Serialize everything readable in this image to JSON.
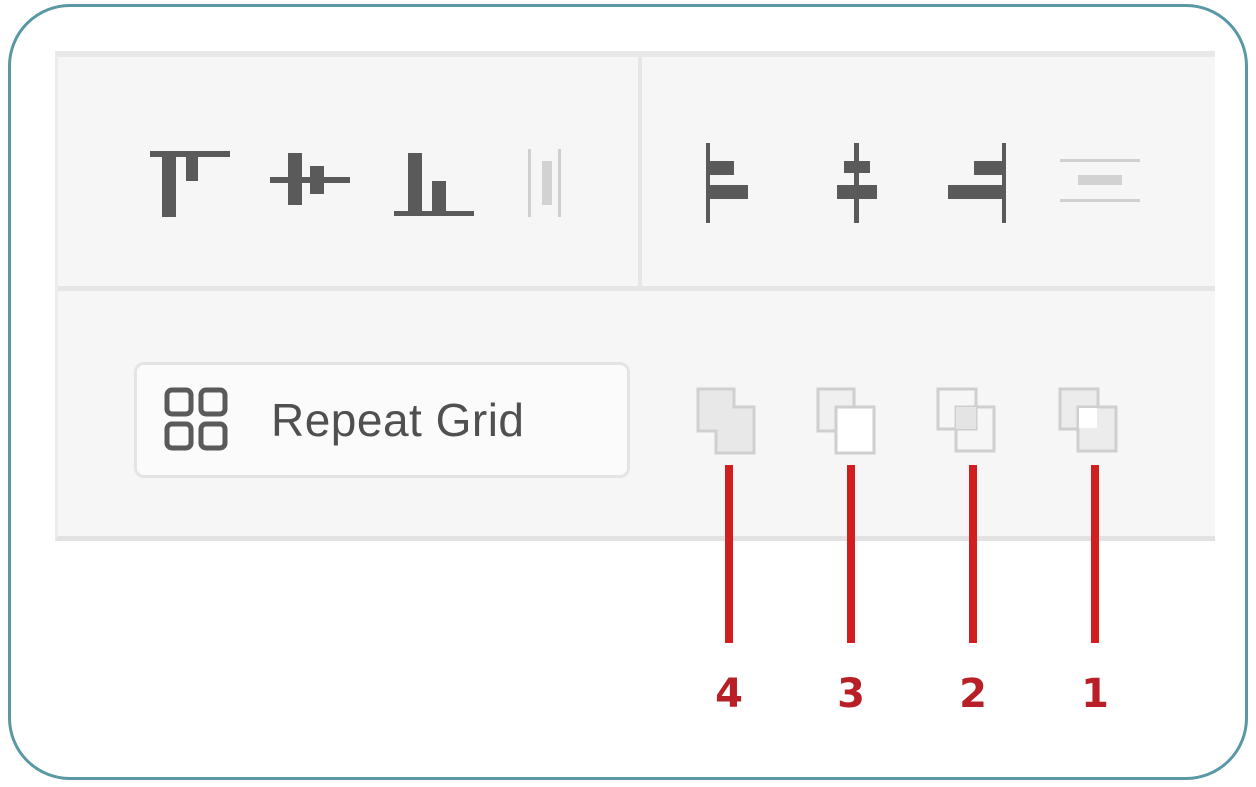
{
  "toolbar": {
    "align_vertical": [
      {
        "name": "align-top",
        "icon": "align-top-icon"
      },
      {
        "name": "align-middle",
        "icon": "align-vertical-center-icon"
      },
      {
        "name": "align-bottom",
        "icon": "align-bottom-icon"
      },
      {
        "name": "distribute-horizontal",
        "icon": "distribute-horizontal-icon"
      }
    ],
    "align_horizontal": [
      {
        "name": "align-left",
        "icon": "align-left-icon"
      },
      {
        "name": "align-center",
        "icon": "align-horizontal-center-icon"
      },
      {
        "name": "align-right",
        "icon": "align-right-icon"
      },
      {
        "name": "distribute-vertical",
        "icon": "distribute-vertical-icon"
      }
    ]
  },
  "repeat_grid": {
    "label": "Repeat Grid",
    "icon": "grid-icon"
  },
  "arrange_buttons": [
    {
      "icon": "union-icon",
      "marker": "4"
    },
    {
      "icon": "subtract-icon",
      "marker": "3"
    },
    {
      "icon": "intersect-icon",
      "marker": "2"
    },
    {
      "icon": "exclude-overlap-icon",
      "marker": "1"
    }
  ],
  "colors": {
    "frame_border": "#5a98a6",
    "marker": "#d11f1f",
    "icon_dark": "#5a5a5a",
    "icon_light": "#c8c8c8"
  }
}
